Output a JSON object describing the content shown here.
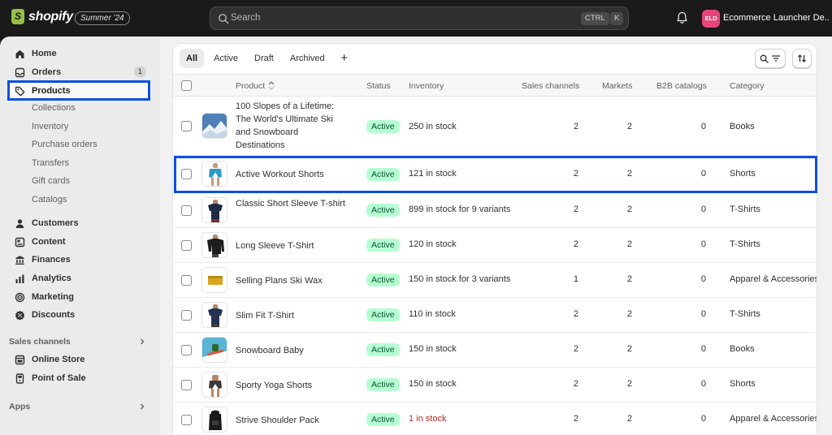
{
  "topbar": {
    "logo_text": "shopify",
    "edition": "Summer '24",
    "search_placeholder": "Search",
    "shortcut_ctrl": "CTRL",
    "shortcut_k": "K",
    "store_initials": "ELD",
    "store_name": "Ecommerce Launcher De..."
  },
  "sidebar": {
    "home": "Home",
    "orders": "Orders",
    "orders_count": "1",
    "products": "Products",
    "sub_items": [
      "Collections",
      "Inventory",
      "Purchase orders",
      "Transfers",
      "Gift cards",
      "Catalogs"
    ],
    "customers": "Customers",
    "content": "Content",
    "finances": "Finances",
    "analytics": "Analytics",
    "marketing": "Marketing",
    "discounts": "Discounts",
    "sales_channels_label": "Sales channels",
    "online_store": "Online Store",
    "point_of_sale": "Point of Sale",
    "apps_label": "Apps"
  },
  "tabs": [
    "All",
    "Active",
    "Draft",
    "Archived"
  ],
  "table": {
    "headers": {
      "product": "Product",
      "status": "Status",
      "inventory": "Inventory",
      "sales_channels": "Sales channels",
      "markets": "Markets",
      "b2b": "B2B catalogs",
      "category": "Category"
    },
    "rows": [
      {
        "name": "100 Slopes of a Lifetime: The World's Ultimate Ski and Snowboard Destinations",
        "status": "Active",
        "inventory": "250 in stock",
        "sales": "2",
        "markets": "2",
        "b2b": "0",
        "category": "Books"
      },
      {
        "name": "Active Workout Shorts",
        "status": "Active",
        "inventory": "121 in stock",
        "sales": "2",
        "markets": "2",
        "b2b": "0",
        "category": "Shorts"
      },
      {
        "name": "Classic Short Sleeve T-shirt",
        "status": "Active",
        "inventory": "899 in stock for 9 variants",
        "sales": "2",
        "markets": "2",
        "b2b": "0",
        "category": "T-Shirts"
      },
      {
        "name": "Long Sleeve T-Shirt",
        "status": "Active",
        "inventory": "120 in stock",
        "sales": "2",
        "markets": "2",
        "b2b": "0",
        "category": "T-Shirts"
      },
      {
        "name": "Selling Plans Ski Wax",
        "status": "Active",
        "inventory": "150 in stock for 3 variants",
        "sales": "1",
        "markets": "2",
        "b2b": "0",
        "category": "Apparel & Accessories"
      },
      {
        "name": "Slim Fit T-Shirt",
        "status": "Active",
        "inventory": "110 in stock",
        "sales": "2",
        "markets": "2",
        "b2b": "0",
        "category": "T-Shirts"
      },
      {
        "name": "Snowboard Baby",
        "status": "Active",
        "inventory": "150 in stock",
        "sales": "2",
        "markets": "2",
        "b2b": "0",
        "category": "Books"
      },
      {
        "name": "Sporty Yoga Shorts",
        "status": "Active",
        "inventory": "150 in stock",
        "sales": "2",
        "markets": "2",
        "b2b": "0",
        "category": "Shorts"
      },
      {
        "name": "Strive Shoulder Pack",
        "status": "Active",
        "inventory": "1 in stock",
        "sales": "2",
        "markets": "2",
        "b2b": "0",
        "category": "Apparel & Accessories"
      }
    ]
  },
  "colors": {
    "highlight": "#0a4fe0",
    "active_badge_bg": "#b4fed2",
    "low_stock": "#b3261e"
  }
}
